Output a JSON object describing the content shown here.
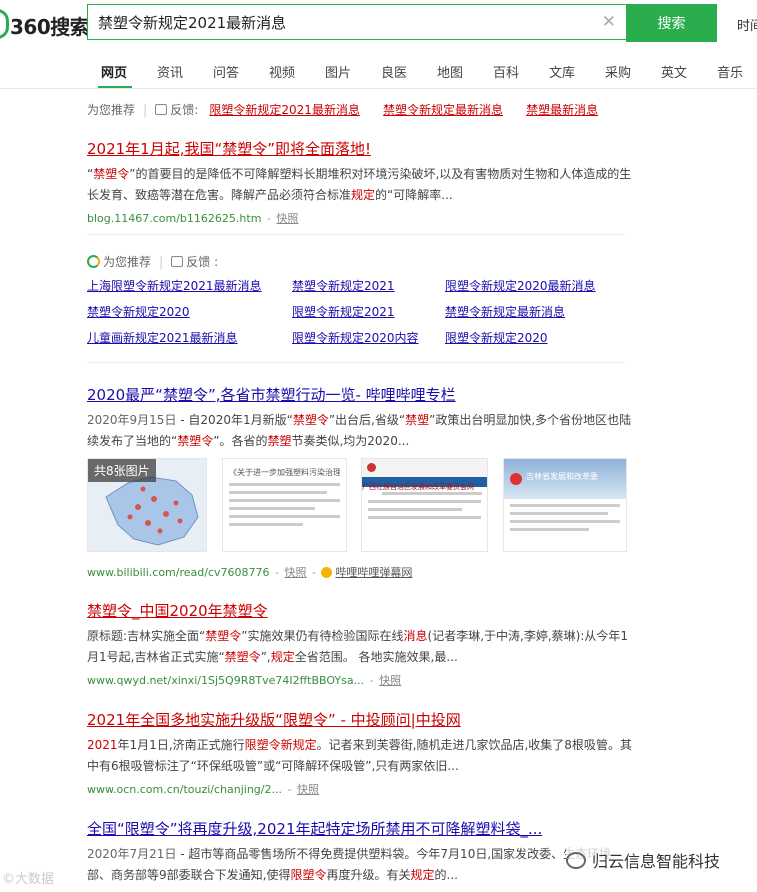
{
  "header": {
    "logo_text": "360搜索",
    "query": "禁塑令新规定2021最新消息",
    "clear_icon": "close-icon",
    "search_button": "搜索",
    "time_button": "时间"
  },
  "nav": {
    "tabs": [
      {
        "label": "网页",
        "active": true
      },
      {
        "label": "资讯"
      },
      {
        "label": "问答"
      },
      {
        "label": "视频"
      },
      {
        "label": "图片"
      },
      {
        "label": "良医"
      },
      {
        "label": "地图"
      },
      {
        "label": "百科"
      },
      {
        "label": "文库"
      },
      {
        "label": "采购"
      },
      {
        "label": "英文"
      },
      {
        "label": "音乐"
      }
    ]
  },
  "recommend_top": {
    "label": "为您推荐",
    "feedback": "反馈",
    "links": [
      "限塑令新规定2021最新消息",
      "禁塑令新规定最新消息",
      "禁塑最新消息"
    ]
  },
  "results": [
    {
      "title": "2021年1月起,我国“禁塑令”即将全面落地!",
      "snippet": "“禁塑令”的首要目的是降低不可降解塑料长期堆积对环境污染破坏,以及有害物质对生物和人体造成的生长发育、致癌等潜在危害。降解产品必须符合标准规定的“可降解率...",
      "url": "blog.11467.com/b1162625.htm",
      "snapshot": "快照"
    },
    {
      "title": "2020最严“禁塑令”,各省市禁塑行动一览- 哔哩哔哩专栏",
      "date": "2020年9月15日",
      "snippet": "自2020年1月新版“禁塑令”出台后,省级“禁塑”政策出台明显加快,多个省份地区也陆续发布了当地的“禁塑令”。各省的禁塑节奏类似,均为2020...",
      "images_label": "共8张图片",
      "image_texts": [
        "《关于进一步加强塑料污染治理的",
        "广西壮族自治区发展和改革委员会网",
        "吉林省发展和改革委"
      ],
      "url": "www.bilibili.com/read/cv7608776",
      "snapshot": "快照",
      "source": "哔哩哔哩弹幕网"
    },
    {
      "title": "禁塑令_中国2020年禁塑令",
      "snippet": "原标题:吉林实施全面“禁塑令”实施效果仍有待检验国际在线消息(记者李琳,于中涛,李婷,蔡琳):从今年1月1号起,吉林省正式实施“禁塑令”,规定全省范围。 各地实施效果,最...",
      "url": "www.qwyd.net/xinxi/1Sj5Q9R8Tve74I2fftBBOYsa...",
      "snapshot": "快照"
    },
    {
      "title": "2021年全国多地实施升级版“限塑令” - 中投顾问|中投网",
      "snippet": "2021年1月1日,济南正式施行限塑令新规定。记者来到芙蓉街,随机走进几家饮品店,收集了8根吸管。其中有6根吸管标注了“环保纸吸管”或“可降解环保吸管”,只有两家依旧...",
      "url": "www.ocn.com.cn/touzi/chanjing/2...",
      "snapshot": "快照"
    },
    {
      "title": "全国“限塑令”将再度升级,2021年起特定场所禁用不可降解塑料袋_...",
      "date": "2020年7月21日",
      "snippet": "超市等商品零售场所不得免费提供塑料袋。今年7月10日,国家发改委、生态环境部、商务部等9部委联合下发通知,使得限塑令再度升级。有关规定的..."
    }
  ],
  "recommend_grid": {
    "label": "为您推荐",
    "feedback": "反馈 :",
    "links": [
      "上海限塑令新规定2021最新消息",
      "禁塑令新规定2021",
      "限塑令新规定2020最新消息",
      "禁塑令新规定2020",
      "限塑令新规定2021",
      "禁塑令新规定最新消息",
      "儿童画新规定2021最新消息",
      "限塑令新规定2020内容",
      "限塑令新规定2020"
    ]
  },
  "watermarks": {
    "left": "©大数据",
    "right": "归云信息智能科技"
  },
  "colors": {
    "accent": "#2aae4d",
    "link": "#1a0dab",
    "highlight": "#cc0000",
    "url": "#388e3c"
  }
}
